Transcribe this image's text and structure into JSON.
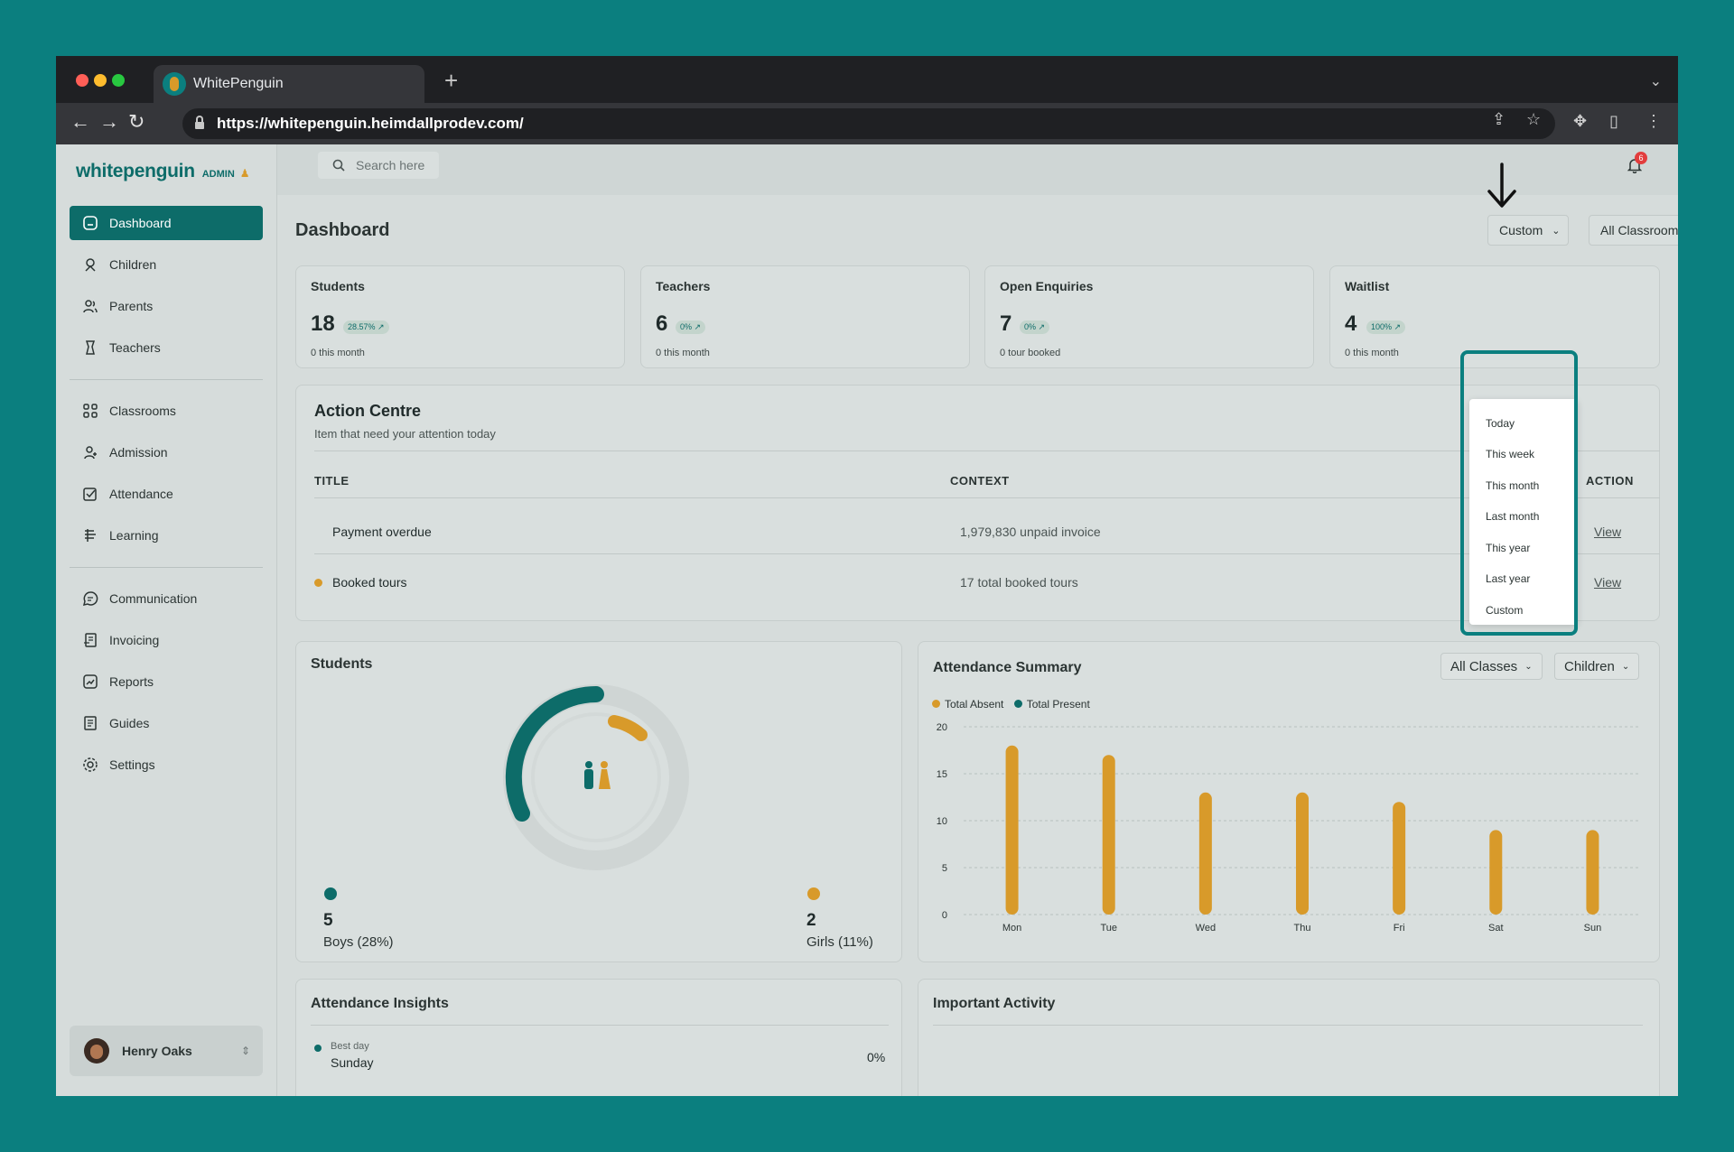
{
  "browser": {
    "tab_title": "WhitePenguin",
    "url": "https://whitepenguin.heimdallprodev.com/"
  },
  "brand": {
    "name": "whitepenguin",
    "role": "ADMIN"
  },
  "colors": {
    "primary": "#0d6c69",
    "accent": "#d89a2a",
    "background": "#0b7f7f"
  },
  "sidebar": {
    "items": [
      {
        "label": "Dashboard",
        "icon": "dashboard-icon",
        "active": true
      },
      {
        "label": "Children",
        "icon": "children-icon"
      },
      {
        "label": "Parents",
        "icon": "parents-icon"
      },
      {
        "label": "Teachers",
        "icon": "teachers-icon"
      },
      {
        "label": "Classrooms",
        "icon": "classrooms-icon"
      },
      {
        "label": "Admission",
        "icon": "admission-icon"
      },
      {
        "label": "Attendance",
        "icon": "attendance-icon"
      },
      {
        "label": "Learning",
        "icon": "learning-icon"
      },
      {
        "label": "Communication",
        "icon": "communication-icon"
      },
      {
        "label": "Invoicing",
        "icon": "invoicing-icon"
      },
      {
        "label": "Reports",
        "icon": "reports-icon"
      },
      {
        "label": "Guides",
        "icon": "guides-icon"
      },
      {
        "label": "Settings",
        "icon": "settings-icon"
      }
    ],
    "user": {
      "name": "Henry Oaks"
    }
  },
  "topbar": {
    "search_placeholder": "Search here",
    "notification_count": "6"
  },
  "page": {
    "title": "Dashboard",
    "date_filter": "Custom",
    "classroom_filter": "All Classrooms"
  },
  "date_dropdown": {
    "options": [
      "Today",
      "This week",
      "This month",
      "Last month",
      "This year",
      "Last year",
      "Custom"
    ]
  },
  "stats": [
    {
      "label": "Students",
      "value": "18",
      "change": "28.57% ↗",
      "sub": "0 this month"
    },
    {
      "label": "Teachers",
      "value": "6",
      "change": "0% ↗",
      "sub": "0 this month"
    },
    {
      "label": "Open Enquiries",
      "value": "7",
      "change": "0% ↗",
      "sub": "0 tour booked"
    },
    {
      "label": "Waitlist",
      "value": "4",
      "change": "100% ↗",
      "sub": "0 this month"
    }
  ],
  "action_centre": {
    "title": "Action Centre",
    "subtitle": "Item that need your attention today",
    "columns": [
      "TITLE",
      "CONTEXT",
      "ACTION"
    ],
    "rows": [
      {
        "title": "Payment overdue",
        "context": "1,979,830 unpaid invoice",
        "action": "View"
      },
      {
        "title": "Booked tours",
        "context": "17 total booked tours",
        "action": "View"
      }
    ]
  },
  "students_card": {
    "title": "Students",
    "boys_count": "5",
    "boys_label": "Boys (28%)",
    "girls_count": "2",
    "girls_label": "Girls (11%)"
  },
  "attendance_summary": {
    "title": "Attendance Summary",
    "class_filter": "All Classes",
    "group_filter": "Children",
    "legend": [
      "Total Absent",
      "Total Present"
    ]
  },
  "chart_data": {
    "type": "bar",
    "categories": [
      "Mon",
      "Tue",
      "Wed",
      "Thu",
      "Fri",
      "Sat",
      "Sun"
    ],
    "series": [
      {
        "name": "Total Absent",
        "values": [
          18,
          17,
          13,
          13,
          12,
          9,
          9
        ]
      },
      {
        "name": "Total Present",
        "values": [
          0,
          0,
          0,
          0,
          0,
          0,
          0
        ]
      }
    ],
    "yticks": [
      "0",
      "5",
      "10",
      "15",
      "20"
    ],
    "ylim": [
      0,
      20
    ],
    "grid": true,
    "legend": "top-left"
  },
  "attendance_insights": {
    "title": "Attendance Insights",
    "best_day_label": "Best day",
    "best_day_value": "Sunday",
    "best_day_pct": "0%"
  },
  "important_activity": {
    "title": "Important Activity"
  }
}
